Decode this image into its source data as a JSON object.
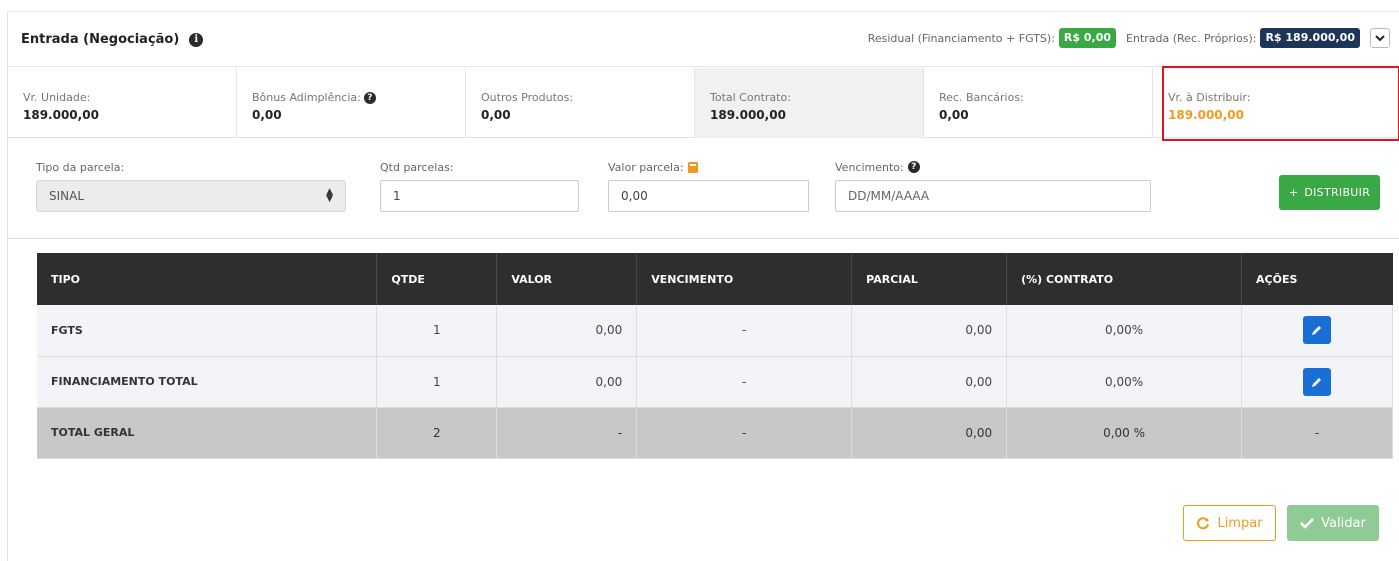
{
  "header": {
    "title": "Entrada (Negociação)",
    "residual_label": "Residual (Financiamento + FGTS):",
    "residual_value": "R$ 0,00",
    "entrada_label": "Entrada (Rec. Próprios):",
    "entrada_value": "R$ 189.000,00"
  },
  "summary": [
    {
      "label": "Vr. Unidade:",
      "value": "189.000,00"
    },
    {
      "label": "Bônus Adimplência:",
      "value": "0,00"
    },
    {
      "label": "Outros Produtos:",
      "value": "0,00"
    },
    {
      "label": "Total Contrato:",
      "value": "189.000,00"
    },
    {
      "label": "Rec. Bancários:",
      "value": "0,00"
    },
    {
      "label": "Vr. à Distribuir:",
      "value": "189.000,00"
    }
  ],
  "form": {
    "tipo_label": "Tipo da parcela:",
    "tipo_value": "SINAL",
    "qtd_label": "Qtd parcelas:",
    "qtd_value": "1",
    "valor_label": "Valor parcela:",
    "valor_value": "0,00",
    "venc_label": "Vencimento:",
    "venc_placeholder": "DD/MM/AAAA",
    "distribuir_label": "DISTRIBUIR"
  },
  "table": {
    "headers": [
      "TIPO",
      "QTDE",
      "VALOR",
      "VENCIMENTO",
      "PARCIAL",
      "(%) CONTRATO",
      "AÇÕES"
    ],
    "rows": [
      {
        "tipo": "FGTS",
        "qtde": "1",
        "valor": "0,00",
        "vencimento": "-",
        "parcial": "0,00",
        "contrato": "0,00%"
      },
      {
        "tipo": "FINANCIAMENTO TOTAL",
        "qtde": "1",
        "valor": "0,00",
        "vencimento": "-",
        "parcial": "0,00",
        "contrato": "0,00%"
      }
    ],
    "total": {
      "tipo": "TOTAL GERAL",
      "qtde": "2",
      "valor": "-",
      "vencimento": "-",
      "parcial": "0,00",
      "contrato": "0,00 %",
      "acoes": "-"
    }
  },
  "actions": {
    "limpar_label": "Limpar",
    "validar_label": "Validar"
  },
  "colors": {
    "green": "#3aa845",
    "navy": "#1d3557",
    "orange": "#f39a1e",
    "blue": "#1a6fd6",
    "red_highlight": "#e0141e"
  }
}
